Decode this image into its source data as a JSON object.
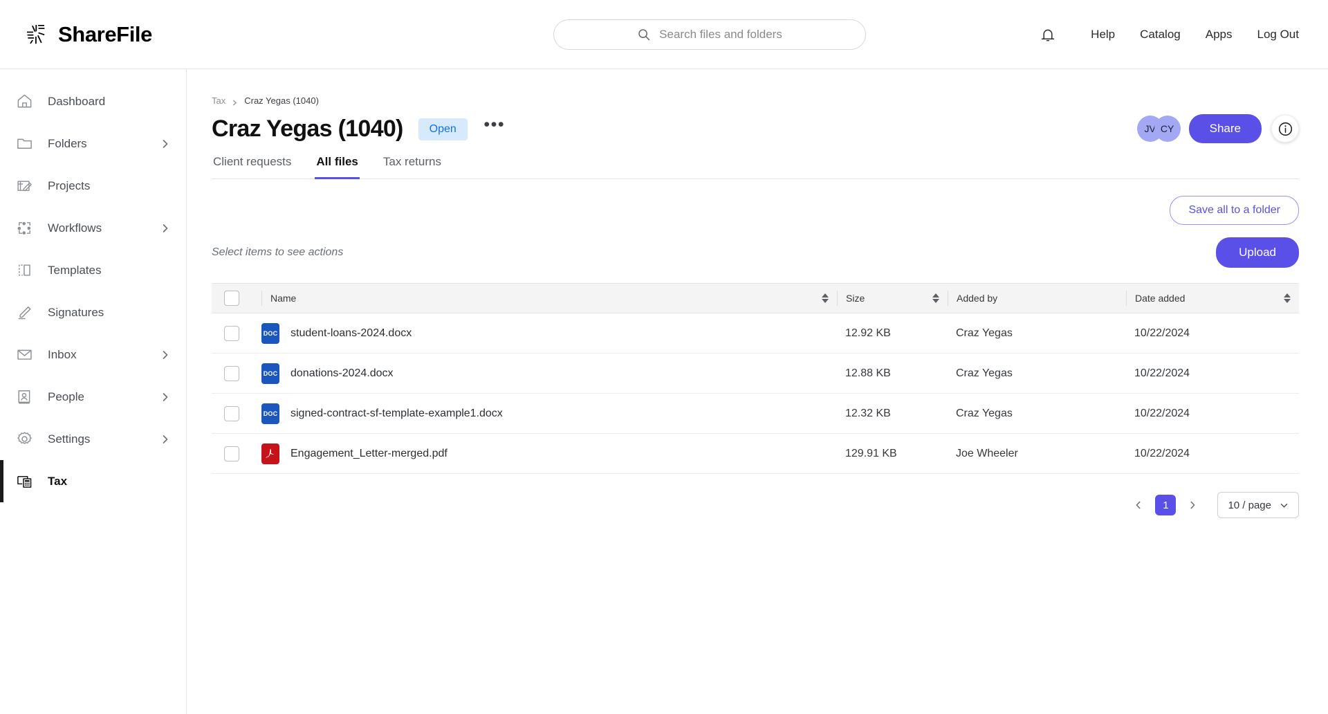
{
  "brand": {
    "name": "ShareFile",
    "logo_icon": "sharefile-star-icon"
  },
  "search": {
    "placeholder": "Search files and folders",
    "icon": "search-icon"
  },
  "topnav": {
    "bell_icon": "notification-bell-icon",
    "links": [
      {
        "label": "Help"
      },
      {
        "label": "Catalog"
      },
      {
        "label": "Apps"
      },
      {
        "label": "Log Out"
      }
    ]
  },
  "sidebar": {
    "items": [
      {
        "label": "Dashboard",
        "icon": "home-icon",
        "chevron": false,
        "active": false
      },
      {
        "label": "Folders",
        "icon": "folder-icon",
        "chevron": true,
        "active": false
      },
      {
        "label": "Projects",
        "icon": "projects-icon",
        "chevron": false,
        "active": false
      },
      {
        "label": "Workflows",
        "icon": "workflows-icon",
        "chevron": true,
        "active": false
      },
      {
        "label": "Templates",
        "icon": "templates-icon",
        "chevron": false,
        "active": false
      },
      {
        "label": "Signatures",
        "icon": "signature-pen-icon",
        "chevron": false,
        "active": false
      },
      {
        "label": "Inbox",
        "icon": "envelope-icon",
        "chevron": true,
        "active": false
      },
      {
        "label": "People",
        "icon": "person-card-icon",
        "chevron": true,
        "active": false
      },
      {
        "label": "Settings",
        "icon": "gear-icon",
        "chevron": true,
        "active": false
      },
      {
        "label": "Tax",
        "icon": "tax-calculator-icon",
        "chevron": false,
        "active": true
      }
    ]
  },
  "breadcrumb": {
    "root": "Tax",
    "current": "Craz Yegas (1040)"
  },
  "header": {
    "title": "Craz Yegas (1040)",
    "status": "Open",
    "more_menu": "•••",
    "avatars": [
      "JV",
      "CY"
    ],
    "share_label": "Share",
    "info_icon": "info-circle-icon"
  },
  "tabs": [
    {
      "label": "Client requests",
      "active": false
    },
    {
      "label": "All files",
      "active": true
    },
    {
      "label": "Tax returns",
      "active": false
    }
  ],
  "toolbar": {
    "save_all_label": "Save all to a folder",
    "hint": "Select items to see actions",
    "upload_label": "Upload"
  },
  "table": {
    "columns": [
      {
        "label": "Name"
      },
      {
        "label": "Size"
      },
      {
        "label": "Added by"
      },
      {
        "label": "Date added"
      }
    ],
    "rows": [
      {
        "name": "student-loans-2024.docx",
        "type": "DOC",
        "size": "12.92 KB",
        "added_by": "Craz Yegas",
        "date_added": "10/22/2024"
      },
      {
        "name": "donations-2024.docx",
        "type": "DOC",
        "size": "12.88 KB",
        "added_by": "Craz Yegas",
        "date_added": "10/22/2024"
      },
      {
        "name": "signed-contract-sf-template-example1.docx",
        "type": "DOC",
        "size": "12.32 KB",
        "added_by": "Craz Yegas",
        "date_added": "10/22/2024"
      },
      {
        "name": "Engagement_Letter-merged.pdf",
        "type": "PDF",
        "size": "129.91 KB",
        "added_by": "Joe Wheeler",
        "date_added": "10/22/2024"
      }
    ]
  },
  "pagination": {
    "current_page": "1",
    "per_page": "10 / page"
  },
  "colors": {
    "accent": "#5a50e8",
    "badge_bg": "#d6eafc",
    "badge_text": "#1273de",
    "avatar_bg": "#a3a8f5",
    "doc_icon": "#1a56bd",
    "pdf_icon": "#c6131a"
  }
}
